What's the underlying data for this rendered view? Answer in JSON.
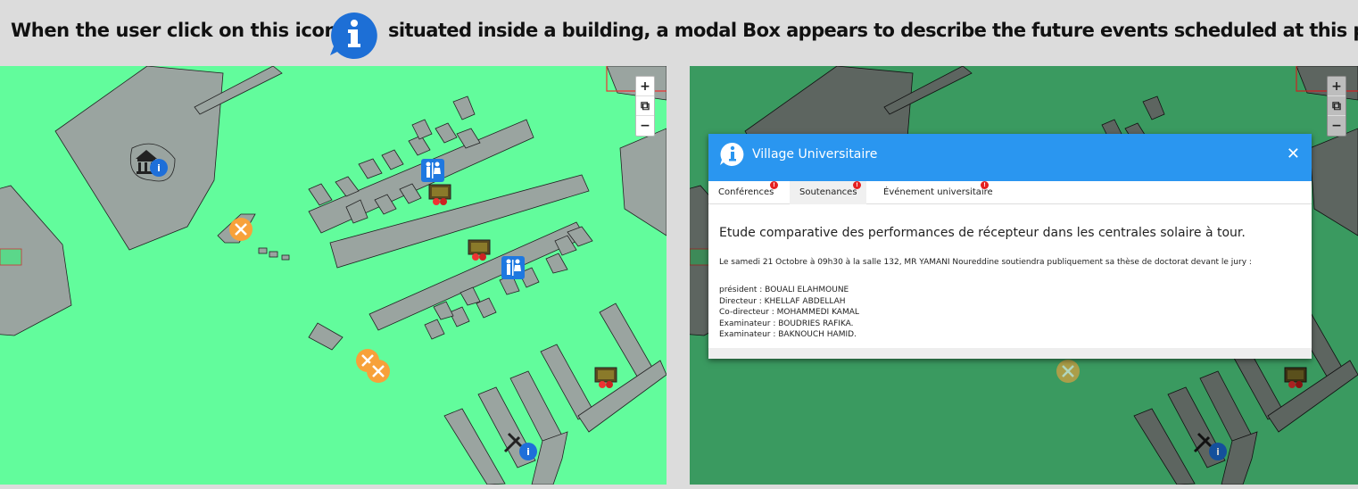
{
  "caption": {
    "before_icon": "When the user click on this icone",
    "after_icon": "situated inside a building, a modal Box appears to describe the future events scheduled at this place."
  },
  "map": {
    "zoom_in": "+",
    "fullscreen": "⧉",
    "zoom_out": "−",
    "colors": {
      "grass": "#62fc9c",
      "grass_dim": "#3a9a60",
      "building": "#9aa4a0",
      "building_dim": "#5d6560",
      "info": "#1e6fd9",
      "food": "#f7a13a"
    }
  },
  "modal": {
    "title": "Village Universitaire",
    "close": "✕",
    "tabs": [
      {
        "label": "Conférences",
        "badge": "!"
      },
      {
        "label": "Soutenances",
        "badge": "!"
      },
      {
        "label": "Événement universitaire",
        "badge": "!"
      }
    ],
    "active_tab": "Soutenances",
    "heading": "Etude comparative des performances de récepteur dans les centrales solaire à tour.",
    "intro": "Le samedi 21 Octobre à 09h30 à la salle 132, MR YAMANI Noureddine soutiendra publiquement sa thèse de doctorat devant le jury :",
    "jury": [
      "président : BOUALI ELAHMOUNE",
      "Directeur : KHELLAF ABDELLAH",
      "Co-directeur : MOHAMMEDI KAMAL",
      "Examinateur : BOUDRIES RAFIKA.",
      "Examinateur : BAKNOUCH HAMID."
    ]
  }
}
